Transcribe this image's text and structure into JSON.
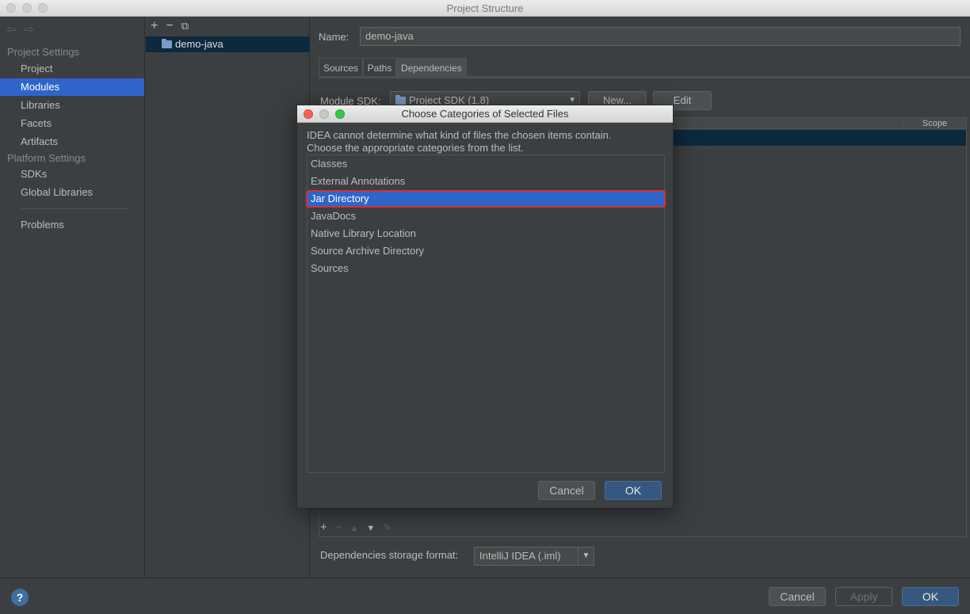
{
  "window": {
    "title": "Project Structure"
  },
  "nav": {
    "back_icon": "back-arrow-icon",
    "forward_icon": "forward-arrow-icon"
  },
  "sidebar": {
    "project_settings_header": "Project Settings",
    "project_items": [
      "Project",
      "Modules",
      "Libraries",
      "Facets",
      "Artifacts"
    ],
    "selected": "Modules",
    "platform_settings_header": "Platform Settings",
    "platform_items": [
      "SDKs",
      "Global Libraries"
    ],
    "problems": "Problems"
  },
  "tree": {
    "tool_add": "+",
    "tool_remove": "−",
    "module_name": "demo-java"
  },
  "content": {
    "name_label": "Name:",
    "name_value": "demo-java",
    "tabs": [
      "Sources",
      "Paths",
      "Dependencies"
    ],
    "active_tab": "Dependencies",
    "sdk_label": "Module SDK:",
    "sdk_value": "Project SDK (1.8)",
    "new_button": "New...",
    "edit_button": "Edit",
    "scope_header": "Scope",
    "tools_add": "+",
    "tools_remove": "−",
    "storage_label": "Dependencies storage format:",
    "storage_value": "IntelliJ IDEA (.iml)"
  },
  "dialog": {
    "title": "Choose Categories of Selected Files",
    "message_line1": "IDEA cannot determine what kind of files the chosen items contain.",
    "message_line2": "Choose the appropriate categories from the list.",
    "items": [
      "Classes",
      "External Annotations",
      "Jar Directory",
      "JavaDocs",
      "Native Library Location",
      "Source Archive Directory",
      "Sources"
    ],
    "selected": "Jar Directory",
    "highlight_color": "#d33232",
    "cancel_button": "Cancel",
    "ok_button": "OK"
  },
  "footer": {
    "help": "?",
    "cancel_button": "Cancel",
    "apply_button": "Apply",
    "ok_button": "OK"
  }
}
